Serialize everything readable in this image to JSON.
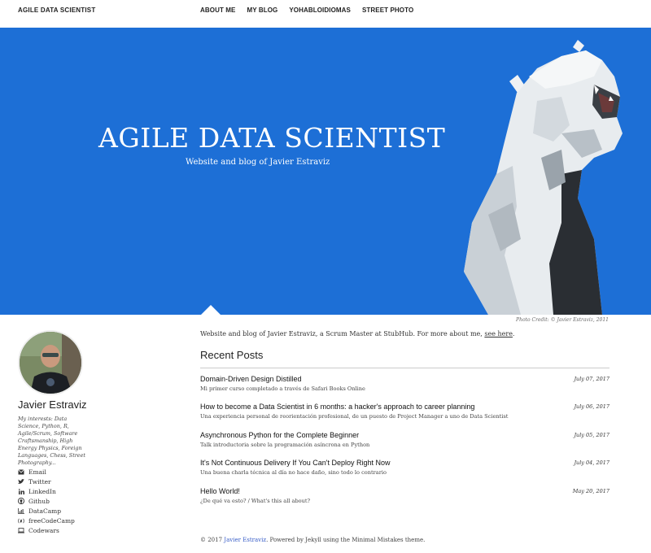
{
  "nav": {
    "site_title": "AGILE DATA SCIENTIST",
    "links": [
      "ABOUT ME",
      "MY BLOG",
      "YOHABLOIDIOMAS",
      "STREET PHOTO"
    ]
  },
  "hero": {
    "title": "AGILE DATA SCIENTIST",
    "subtitle": "Website and blog of Javier Estraviz",
    "bg_color": "#1d6fd6",
    "image": "marble-tiger-statue"
  },
  "photo_credit": "Photo Credit: © Javier Estraviz, 2011",
  "author": {
    "name": "Javier Estraviz",
    "bio": "My interests: Data Science, Python, R, Agile/Scrum, Software Craftsmanship, High Energy Physics, Foreign Languages, Chess, Street Photography...",
    "links": [
      {
        "label": "Email",
        "icon": "envelope-icon"
      },
      {
        "label": "Twitter",
        "icon": "twitter-icon"
      },
      {
        "label": "LinkedIn",
        "icon": "linkedin-icon"
      },
      {
        "label": "Github",
        "icon": "github-icon"
      },
      {
        "label": "DataCamp",
        "icon": "chart-icon"
      },
      {
        "label": "freeCodeCamp",
        "icon": "fire-icon"
      },
      {
        "label": "Codewars",
        "icon": "laptop-icon"
      }
    ]
  },
  "main": {
    "intro_text": "Website and blog of Javier Estraviz, a Scrum Master at StubHub. For more about me, ",
    "intro_link": "see here",
    "intro_end": ".",
    "recent_title": "Recent Posts",
    "posts": [
      {
        "title": "Domain-Driven Design Distilled",
        "excerpt": "Mi primer curso completado a través de Safari Books Online",
        "date": "July 07, 2017"
      },
      {
        "title": "How to become a Data Scientist in 6 months: a hacker's approach to career planning",
        "excerpt": "Una experiencia personal de reorientación profesional, de un puesto de Project Manager a uno de Data Scientist",
        "date": "July 06, 2017"
      },
      {
        "title": "Asynchronous Python for the Complete Beginner",
        "excerpt": "Talk introductoria sobre la programación asíncrona en Python",
        "date": "July 05, 2017"
      },
      {
        "title": "It's Not Continuous Delivery If You Can't Deploy Right Now",
        "excerpt": "Una buena charla técnica al día no hace daño, sino todo lo contrario",
        "date": "July 04, 2017"
      },
      {
        "title": "Hello World!",
        "excerpt": "¿De qué va esto? / What's this all about?",
        "date": "May 20, 2017"
      }
    ]
  },
  "footer": {
    "prefix": "© 2017 ",
    "author_link": "Javier Estraviz",
    "suffix": ". Powered by Jekyll using the Minimal Mistakes theme."
  }
}
